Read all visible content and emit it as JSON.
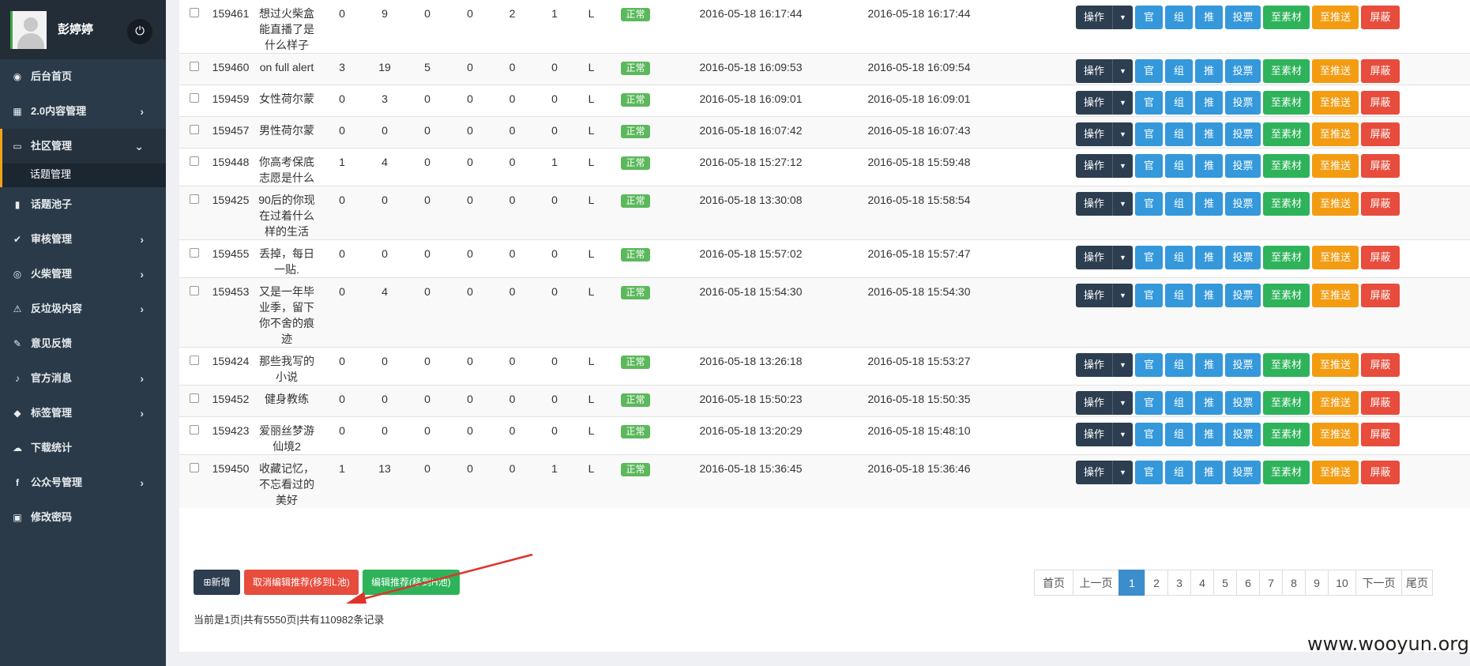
{
  "user": {
    "name": "彭婷婷"
  },
  "sidebar": {
    "items": [
      {
        "label": "后台首页",
        "icon": "dashboard-icon",
        "glyph": "◉",
        "chevron": false
      },
      {
        "label": "2.0内容管理",
        "icon": "calendar-icon",
        "glyph": "▦",
        "chevron": true
      },
      {
        "label": "社区管理",
        "icon": "laptop-icon",
        "glyph": "▭",
        "chevron": true,
        "active": true
      },
      {
        "label": "话题池子",
        "icon": "book-icon",
        "glyph": "▮",
        "chevron": false
      },
      {
        "label": "审核管理",
        "icon": "check-circle-icon",
        "glyph": "✔",
        "chevron": true
      },
      {
        "label": "火柴管理",
        "icon": "eye-icon",
        "glyph": "◎",
        "chevron": true
      },
      {
        "label": "反垃圾内容",
        "icon": "warning-icon",
        "glyph": "⚠",
        "chevron": true
      },
      {
        "label": "意见反馈",
        "icon": "pencil-icon",
        "glyph": "✎",
        "chevron": false
      },
      {
        "label": "官方消息",
        "icon": "bell-icon",
        "glyph": "♪",
        "chevron": true
      },
      {
        "label": "标签管理",
        "icon": "tag-icon",
        "glyph": "◆",
        "chevron": true
      },
      {
        "label": "下载统计",
        "icon": "cloud-download-icon",
        "glyph": "☁",
        "chevron": false
      },
      {
        "label": "公众号管理",
        "icon": "facebook-icon",
        "glyph": "f",
        "chevron": true
      },
      {
        "label": "修改密码",
        "icon": "lock-icon",
        "glyph": "▣",
        "chevron": false
      }
    ],
    "subitem": "话题管理"
  },
  "buttons": {
    "op": "操作",
    "guan": "官",
    "zu": "组",
    "tui": "推",
    "vote": "投票",
    "material": "至素材",
    "push": "至推送",
    "block": "屏蔽"
  },
  "rows": [
    {
      "id": "159461",
      "title": "想过火柴盒能直播了是什么样子",
      "c1": "0",
      "c2": "9",
      "c3": "0",
      "c4": "0",
      "c5": "2",
      "c6": "1",
      "level": "L",
      "status": "正常",
      "created": "2016-05-18 16:17:44",
      "updated": "2016-05-18 16:17:44"
    },
    {
      "id": "159460",
      "title": "on full alert",
      "c1": "3",
      "c2": "19",
      "c3": "5",
      "c4": "0",
      "c5": "0",
      "c6": "0",
      "level": "L",
      "status": "正常",
      "created": "2016-05-18 16:09:53",
      "updated": "2016-05-18 16:09:54"
    },
    {
      "id": "159459",
      "title": "女性荷尔蒙",
      "c1": "0",
      "c2": "3",
      "c3": "0",
      "c4": "0",
      "c5": "0",
      "c6": "0",
      "level": "L",
      "status": "正常",
      "created": "2016-05-18 16:09:01",
      "updated": "2016-05-18 16:09:01"
    },
    {
      "id": "159457",
      "title": "男性荷尔蒙",
      "c1": "0",
      "c2": "0",
      "c3": "0",
      "c4": "0",
      "c5": "0",
      "c6": "0",
      "level": "L",
      "status": "正常",
      "created": "2016-05-18 16:07:42",
      "updated": "2016-05-18 16:07:43"
    },
    {
      "id": "159448",
      "title": "你高考保底志愿是什么",
      "c1": "1",
      "c2": "4",
      "c3": "0",
      "c4": "0",
      "c5": "0",
      "c6": "1",
      "level": "L",
      "status": "正常",
      "created": "2016-05-18 15:27:12",
      "updated": "2016-05-18 15:59:48"
    },
    {
      "id": "159425",
      "title": "90后的你现在过着什么样的生活",
      "c1": "0",
      "c2": "0",
      "c3": "0",
      "c4": "0",
      "c5": "0",
      "c6": "0",
      "level": "L",
      "status": "正常",
      "created": "2016-05-18 13:30:08",
      "updated": "2016-05-18 15:58:54"
    },
    {
      "id": "159455",
      "title": "丢掉，每日一贴.",
      "c1": "0",
      "c2": "0",
      "c3": "0",
      "c4": "0",
      "c5": "0",
      "c6": "0",
      "level": "L",
      "status": "正常",
      "created": "2016-05-18 15:57:02",
      "updated": "2016-05-18 15:57:47"
    },
    {
      "id": "159453",
      "title": "又是一年毕业季，留下你不舍的痕迹",
      "c1": "0",
      "c2": "4",
      "c3": "0",
      "c4": "0",
      "c5": "0",
      "c6": "0",
      "level": "L",
      "status": "正常",
      "created": "2016-05-18 15:54:30",
      "updated": "2016-05-18 15:54:30"
    },
    {
      "id": "159424",
      "title": "那些我写的小说",
      "c1": "0",
      "c2": "0",
      "c3": "0",
      "c4": "0",
      "c5": "0",
      "c6": "0",
      "level": "L",
      "status": "正常",
      "created": "2016-05-18 13:26:18",
      "updated": "2016-05-18 15:53:27"
    },
    {
      "id": "159452",
      "title": "健身教练",
      "c1": "0",
      "c2": "0",
      "c3": "0",
      "c4": "0",
      "c5": "0",
      "c6": "0",
      "level": "L",
      "status": "正常",
      "created": "2016-05-18 15:50:23",
      "updated": "2016-05-18 15:50:35"
    },
    {
      "id": "159423",
      "title": "爱丽丝梦游仙境2",
      "c1": "0",
      "c2": "0",
      "c3": "0",
      "c4": "0",
      "c5": "0",
      "c6": "0",
      "level": "L",
      "status": "正常",
      "created": "2016-05-18 13:20:29",
      "updated": "2016-05-18 15:48:10"
    },
    {
      "id": "159450",
      "title": "收藏记忆，不忘看过的美好",
      "c1": "1",
      "c2": "13",
      "c3": "0",
      "c4": "0",
      "c5": "0",
      "c6": "1",
      "level": "L",
      "status": "正常",
      "created": "2016-05-18 15:36:45",
      "updated": "2016-05-18 15:36:46"
    }
  ],
  "footer": {
    "new": "⊞新增",
    "cancel_recommend": "取消编辑推荐(移到L池)",
    "edit_recommend": "编辑推荐(移到H池)",
    "page_info": "当前是1页|共有5550页|共有110982条记录"
  },
  "pager": [
    "首页",
    "上一页",
    "1",
    "2",
    "3",
    "4",
    "5",
    "6",
    "7",
    "8",
    "9",
    "10",
    "下一页",
    "尾页"
  ],
  "pager_current": "1",
  "watermark": "www.wooyun.org",
  "colors": {
    "sidebar": "#2a3a48",
    "accent": "#f0a11a",
    "status_ok": "#5cb85c",
    "pager_active": "#3c8dcc"
  }
}
